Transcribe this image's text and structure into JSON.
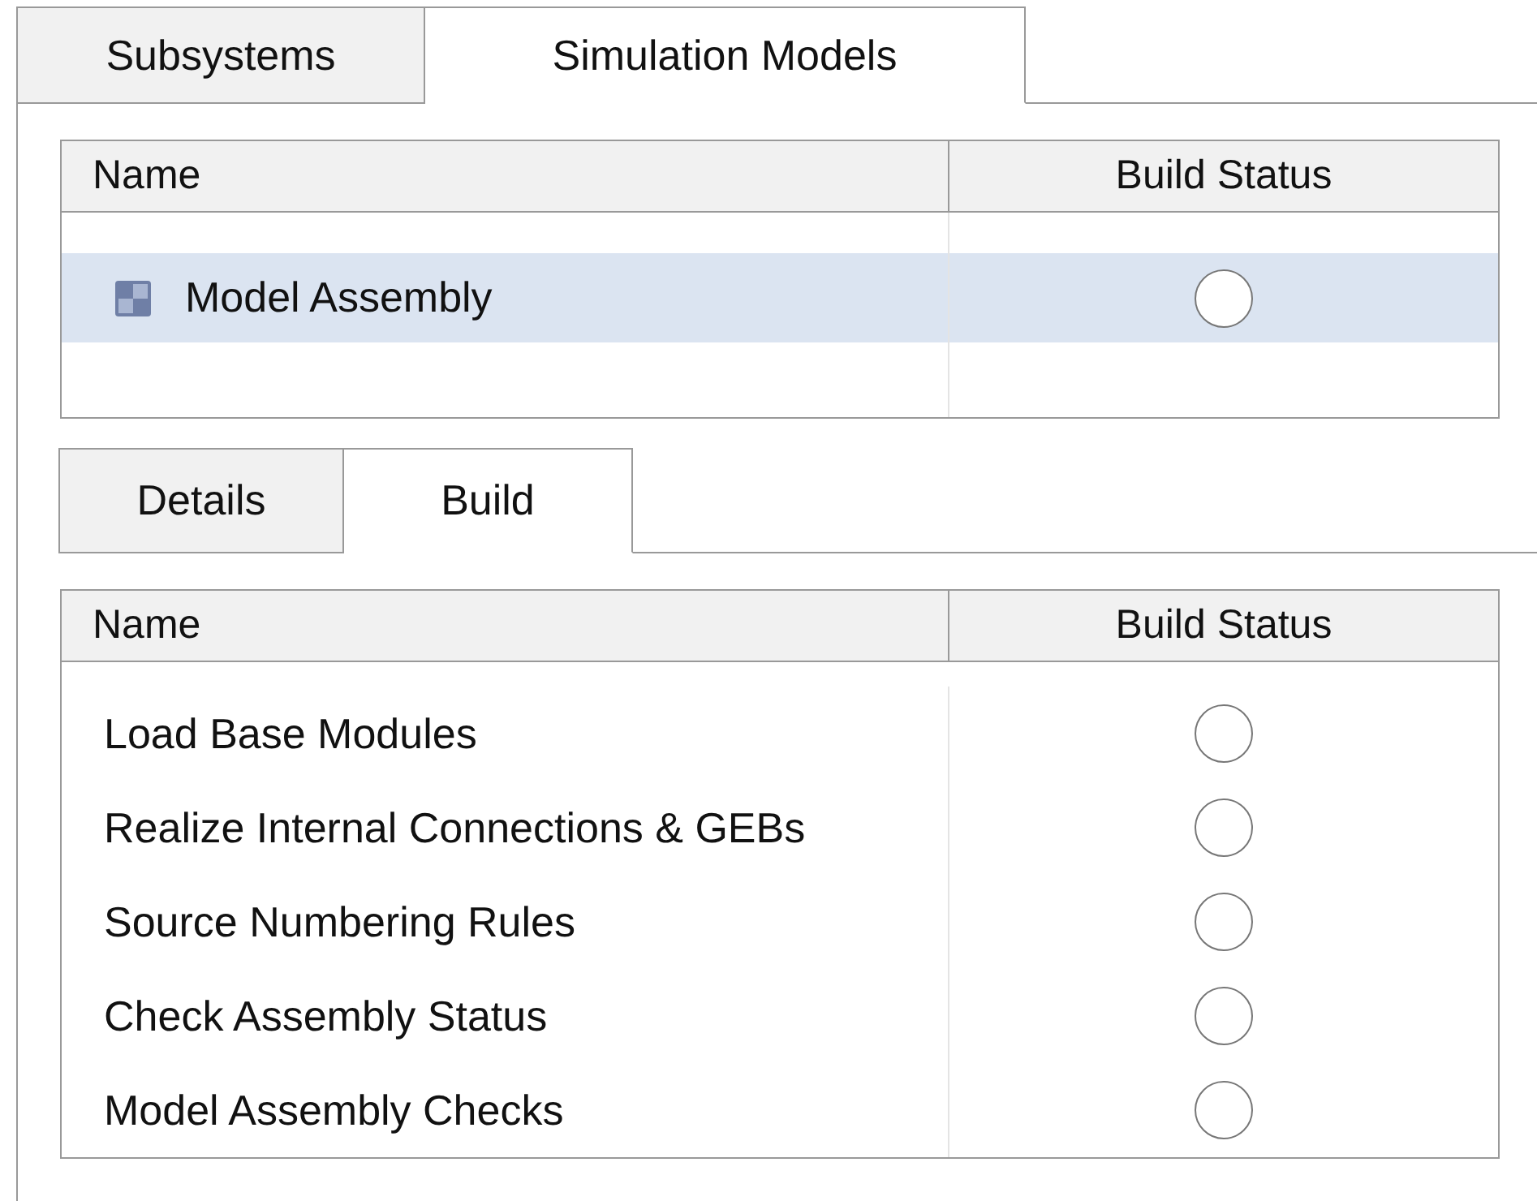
{
  "tabs": [
    {
      "label": "Subsystems",
      "selected": false
    },
    {
      "label": "Simulation Models",
      "selected": true
    }
  ],
  "models_table": {
    "columns": [
      "Name",
      "Build Status"
    ],
    "rows": [
      {
        "name": "Model Assembly",
        "selected": true
      }
    ]
  },
  "detail_tabs": [
    {
      "label": "Details",
      "selected": false
    },
    {
      "label": "Build",
      "selected": true
    }
  ],
  "build_table": {
    "columns": [
      "Name",
      "Build Status"
    ],
    "rows": [
      {
        "name": "Load Base Modules"
      },
      {
        "name": "Realize Internal Connections & GEBs"
      },
      {
        "name": "Source Numbering Rules"
      },
      {
        "name": "Check Assembly Status"
      },
      {
        "name": "Model Assembly Checks"
      }
    ]
  }
}
